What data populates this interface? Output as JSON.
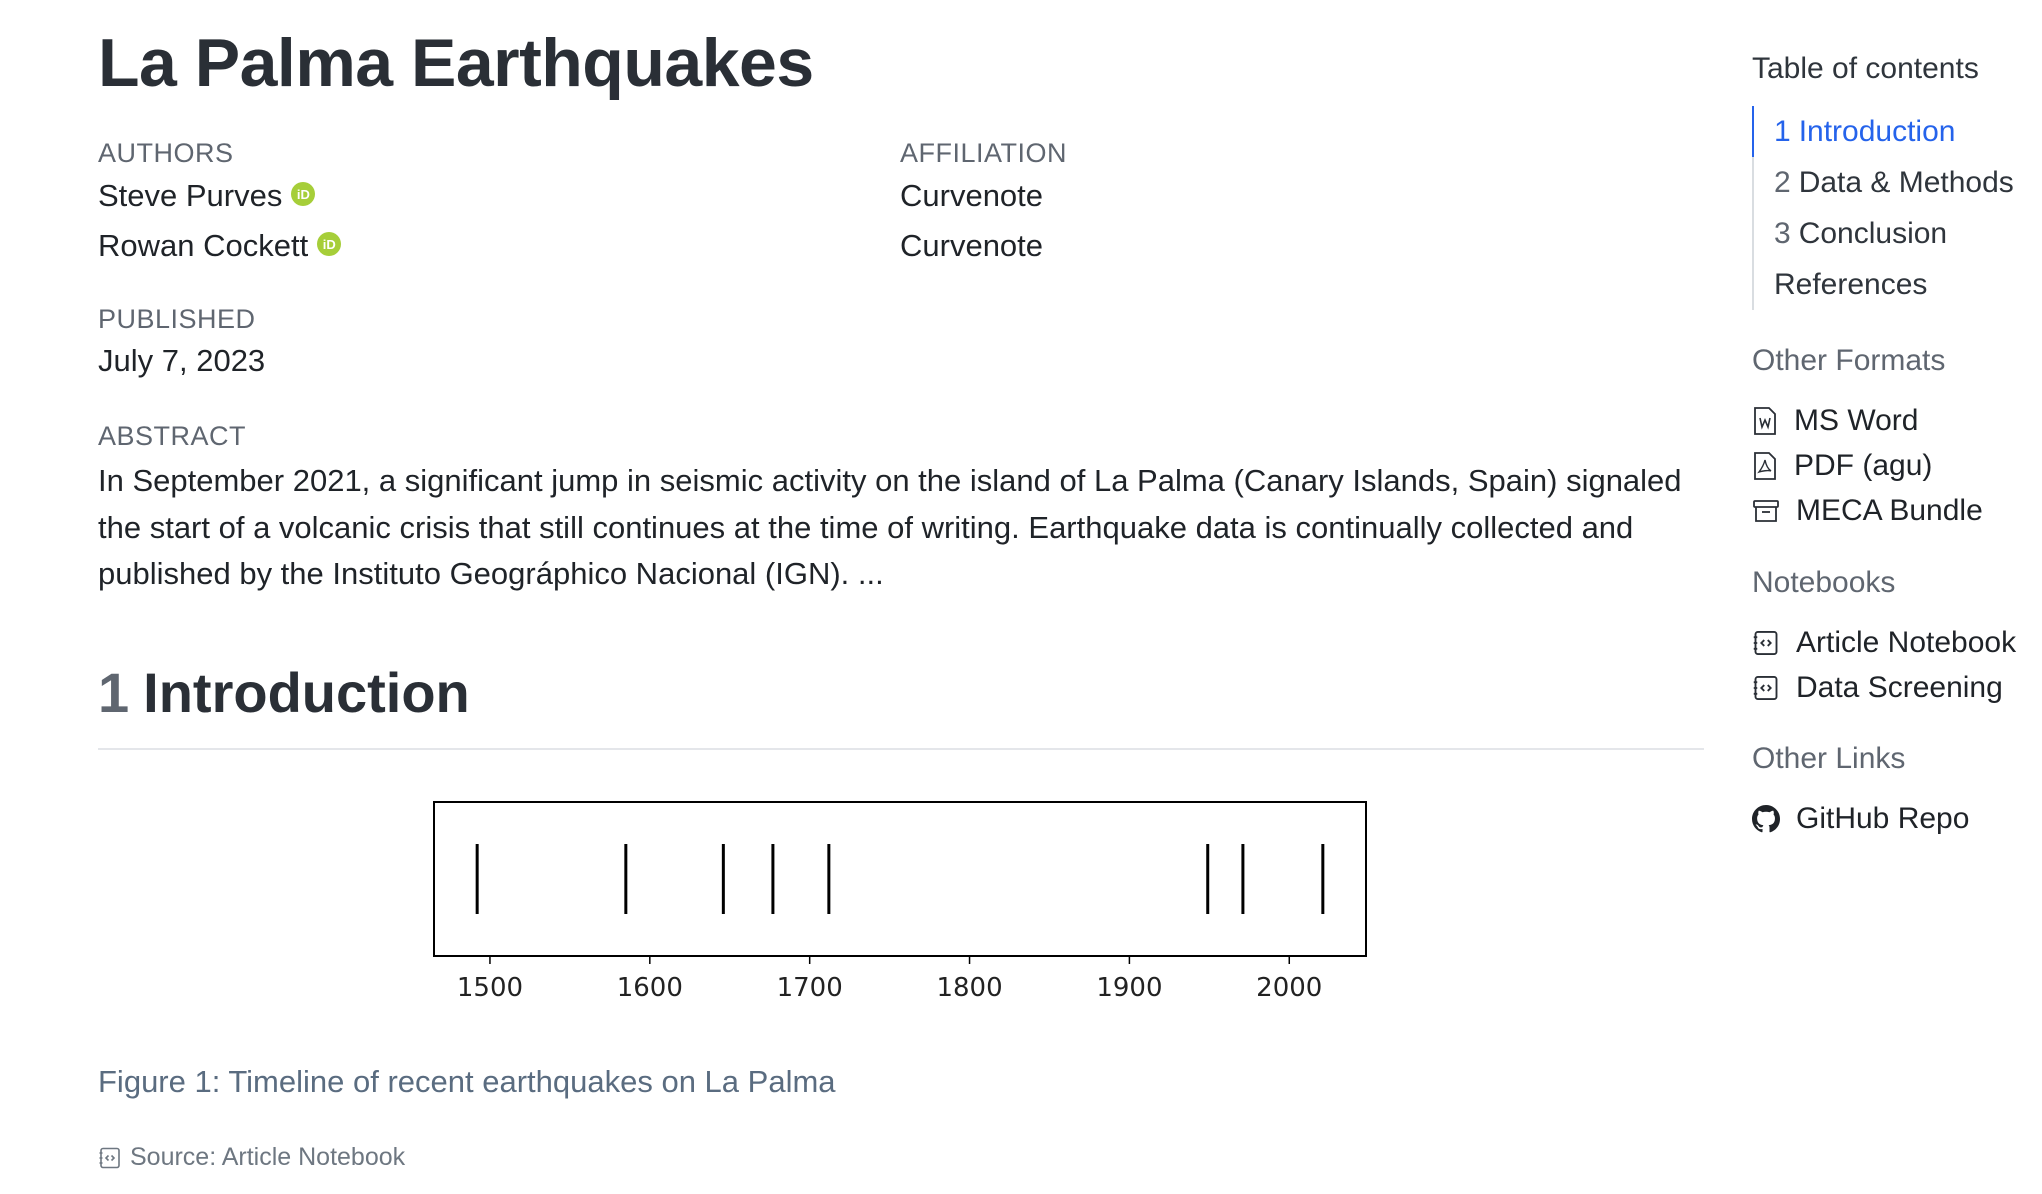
{
  "article": {
    "title": "La Palma Earthquakes",
    "authors_label": "AUTHORS",
    "affiliation_label": "AFFILIATION",
    "authors": [
      {
        "name": "Steve Purves",
        "affiliation": "Curvenote"
      },
      {
        "name": "Rowan Cockett",
        "affiliation": "Curvenote"
      }
    ],
    "published_label": "PUBLISHED",
    "published_date": "July 7, 2023",
    "abstract_label": "ABSTRACT",
    "abstract": "In September 2021, a significant jump in seismic activity on the island of La Palma (Canary Islands, Spain) signaled the start of a volcanic crisis that still continues at the time of writing. Earthquake data is continually collected and published by the Instituto Geográphico Nacional (IGN). ...",
    "section": {
      "number": "1",
      "title": "Introduction"
    },
    "figure_caption": "Figure 1: Timeline of recent earthquakes on La Palma",
    "source_label": "Source: Article Notebook"
  },
  "sidebar": {
    "toc_title": "Table of contents",
    "toc": [
      {
        "num": "1",
        "label": "Introduction",
        "active": true
      },
      {
        "num": "2",
        "label": "Data & Methods",
        "active": false
      },
      {
        "num": "3",
        "label": "Conclusion",
        "active": false
      },
      {
        "num": "",
        "label": "References",
        "active": false
      }
    ],
    "formats_title": "Other Formats",
    "formats": [
      {
        "label": "MS Word",
        "icon": "word-doc-icon"
      },
      {
        "label": "PDF (agu)",
        "icon": "pdf-icon"
      },
      {
        "label": "MECA Bundle",
        "icon": "archive-icon"
      }
    ],
    "notebooks_title": "Notebooks",
    "notebooks": [
      {
        "label": "Article Notebook",
        "icon": "notebook-icon"
      },
      {
        "label": "Data Screening",
        "icon": "notebook-icon"
      }
    ],
    "links_title": "Other Links",
    "links": [
      {
        "label": "GitHub Repo",
        "icon": "github-icon"
      }
    ]
  },
  "chart_data": {
    "type": "scatter",
    "mark": "vertical-tick",
    "x": [
      1492,
      1585,
      1646,
      1677,
      1712,
      1949,
      1971,
      2021
    ],
    "xlim": [
      1465,
      2048
    ],
    "xticks": [
      1500,
      1600,
      1700,
      1800,
      1900,
      2000
    ],
    "xlabel": "",
    "ylabel": "",
    "title": "",
    "grid": false
  }
}
